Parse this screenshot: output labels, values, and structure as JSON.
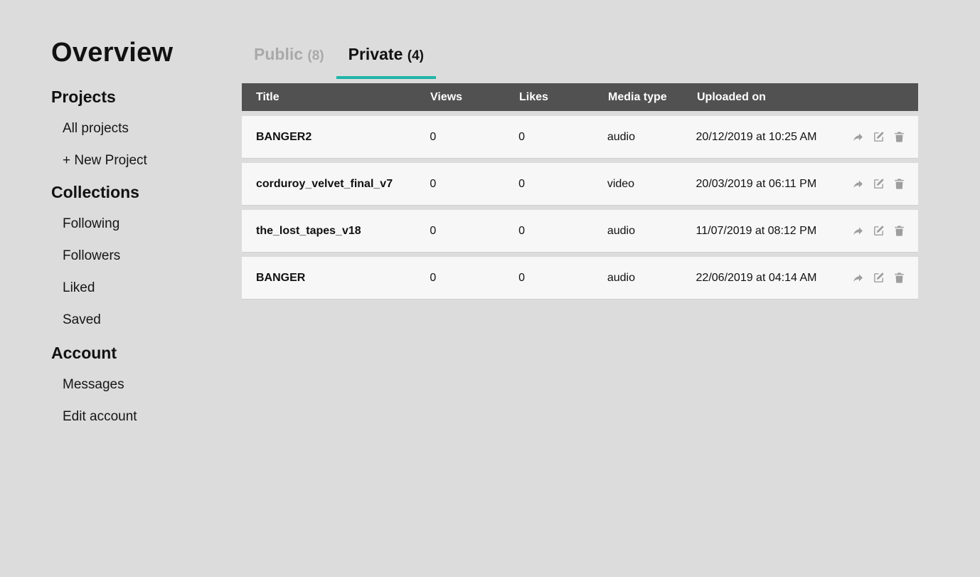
{
  "sidebar": {
    "title": "Overview",
    "sections": [
      {
        "heading": "Projects",
        "items": [
          "All projects",
          "+ New Project"
        ]
      },
      {
        "heading": "Collections",
        "items": [
          "Following",
          "Followers",
          "Liked",
          "Saved"
        ]
      },
      {
        "heading": "Account",
        "items": [
          "Messages",
          "Edit account"
        ]
      }
    ]
  },
  "tabs": [
    {
      "label": "Public",
      "count": "(8)",
      "active": false
    },
    {
      "label": "Private",
      "count": "(4)",
      "active": true
    }
  ],
  "table": {
    "headers": [
      "Title",
      "Views",
      "Likes",
      "Media type",
      "Uploaded on"
    ],
    "rows": [
      {
        "title": "BANGER2",
        "views": "0",
        "likes": "0",
        "media": "audio",
        "date": "20/12/2019 at 10:25 AM"
      },
      {
        "title": "corduroy_velvet_final_v7",
        "views": "0",
        "likes": "0",
        "media": "video",
        "date": "20/03/2019 at 06:11 PM"
      },
      {
        "title": "the_lost_tapes_v18",
        "views": "0",
        "likes": "0",
        "media": "audio",
        "date": "11/07/2019 at 08:12 PM"
      },
      {
        "title": "BANGER",
        "views": "0",
        "likes": "0",
        "media": "audio",
        "date": "22/06/2019 at 04:14 AM"
      }
    ],
    "row_actions": [
      "share-icon",
      "edit-icon",
      "trash-icon"
    ]
  },
  "colors": {
    "background": "#dcdcdc",
    "header_bg": "#515151",
    "row_bg": "#f7f7f7",
    "accent": "#1fb5a8",
    "icon": "#9e9e9e",
    "inactive_tab": "#a9a9a9"
  }
}
